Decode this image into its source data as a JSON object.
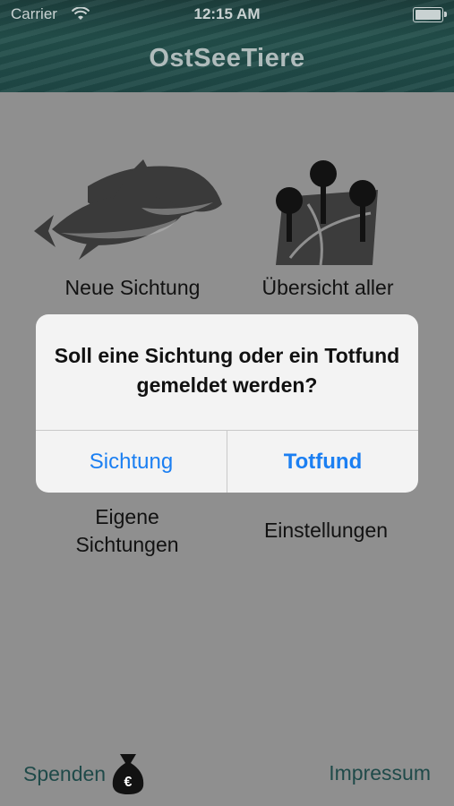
{
  "status_bar": {
    "carrier": "Carrier",
    "time": "12:15 AM"
  },
  "header": {
    "title": "OstSeeTiere"
  },
  "tiles": [
    {
      "label": "Neue Sichtung",
      "icon": "porpoise-icon"
    },
    {
      "label": "Übersicht aller",
      "icon": "map-pins-icon"
    },
    {
      "label_line1": "Eigene",
      "label_line2": "Sichtungen"
    },
    {
      "label": "Einstellungen"
    }
  ],
  "footer": {
    "donate": "Spenden",
    "imprint": "Impressum",
    "donate_icon": "money-bag-icon"
  },
  "alert": {
    "message": "Soll eine Sichtung oder ein Totfund gemeldet werden?",
    "buttons": [
      "Sichtung",
      "Totfund"
    ]
  },
  "colors": {
    "header": "#1f4846",
    "background": "#8f8f8f",
    "accent": "#1b7ff2",
    "footer_text": "#1f4a49"
  }
}
